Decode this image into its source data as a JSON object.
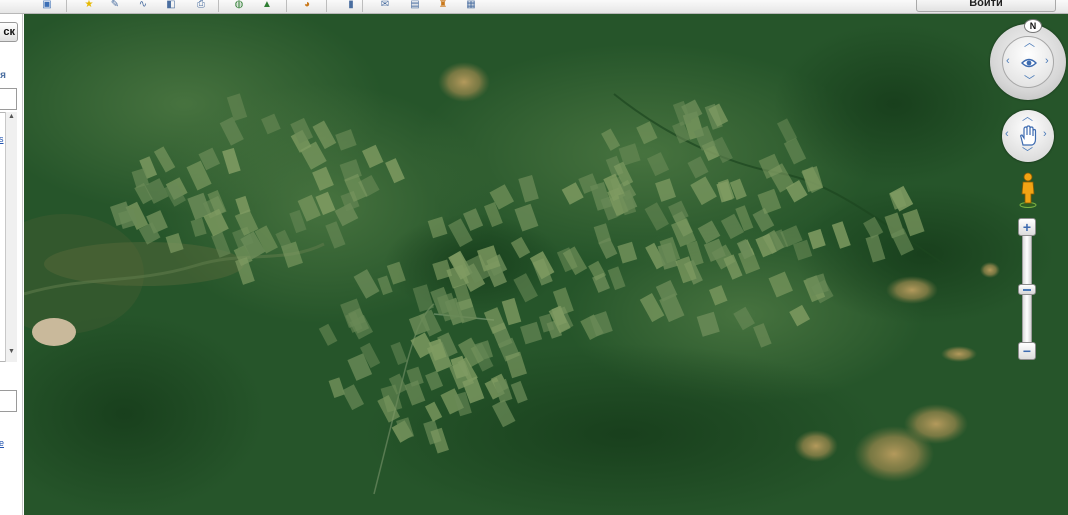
{
  "toolbar": {
    "login_label": "Войти",
    "buttons": [
      {
        "name": "panel-toggle-icon",
        "glyph": "▣",
        "color": "#3b6fb6"
      },
      {
        "name": "star-icon",
        "glyph": "★",
        "color": "#e6b800"
      },
      {
        "name": "pencil-icon",
        "glyph": "✎",
        "color": "#4a6ea0"
      },
      {
        "name": "path-icon",
        "glyph": "∿",
        "color": "#4a6ea0"
      },
      {
        "name": "layers-icon",
        "glyph": "◧",
        "color": "#4a6ea0"
      },
      {
        "name": "print-icon",
        "glyph": "⎙",
        "color": "#4a6ea0"
      },
      {
        "name": "globe-icon",
        "glyph": "◍",
        "color": "#2e7d32"
      },
      {
        "name": "photo-icon",
        "glyph": "▲",
        "color": "#2e7d32"
      },
      {
        "name": "planet-icon",
        "glyph": "◕",
        "color": "#c9781a"
      },
      {
        "name": "ruler-icon",
        "glyph": "▮",
        "color": "#4a6ea0"
      },
      {
        "name": "email-icon",
        "glyph": "✉",
        "color": "#4a6ea0"
      },
      {
        "name": "save-image-icon",
        "glyph": "▤",
        "color": "#4a6ea0"
      },
      {
        "name": "street-view-icon",
        "glyph": "♜",
        "color": "#c9781a"
      },
      {
        "name": "image-icon",
        "glyph": "▦",
        "color": "#4a6ea0"
      }
    ]
  },
  "left_panel": {
    "search_button_label": "ск",
    "label": "ия",
    "link_a": "s",
    "link_b": "e",
    "scroll_up": "▲",
    "scroll_down": "▼"
  },
  "map": {
    "north_label": "N",
    "zoom_in": "+",
    "zoom_out": "−",
    "zoom_level_fraction": 0.5
  },
  "colors": {
    "forest": "#245125",
    "accent": "#3b6fb6"
  }
}
